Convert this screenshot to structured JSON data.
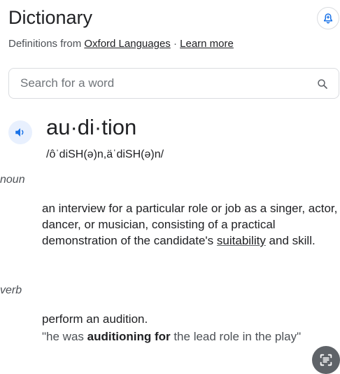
{
  "header": {
    "title": "Dictionary",
    "subtitle_prefix": "Definitions from ",
    "source_link": "Oxford Languages",
    "separator": " · ",
    "learn_more": "Learn more"
  },
  "search": {
    "placeholder": "Search for a word",
    "value": ""
  },
  "entry": {
    "headword": "au·di·tion",
    "phonetic": "/ôˈdiSH(ə)n,äˈdiSH(ə)n/",
    "senses": [
      {
        "pos": "noun",
        "definition_main": "an interview for a particular role or job as a singer, actor, dancer, or musician, consisting of a practical demonstration of the candidate's ",
        "definition_link": "suitability",
        "definition_end": " and skill."
      },
      {
        "pos": "verb",
        "definition": "perform an audition.",
        "example_start": "\"he was ",
        "example_bold": "auditioning for",
        "example_end": " the lead role in the play\""
      }
    ]
  },
  "icons": {
    "bell": "bell-plus-icon",
    "search": "search-icon",
    "speaker": "speaker-icon",
    "lens": "lens-text-icon"
  },
  "colors": {
    "text": "#202124",
    "secondary_text": "#4d5156",
    "speaker_blue": "#1a73e8",
    "speaker_bg": "#e8f0fe",
    "border": "#dadce0"
  }
}
